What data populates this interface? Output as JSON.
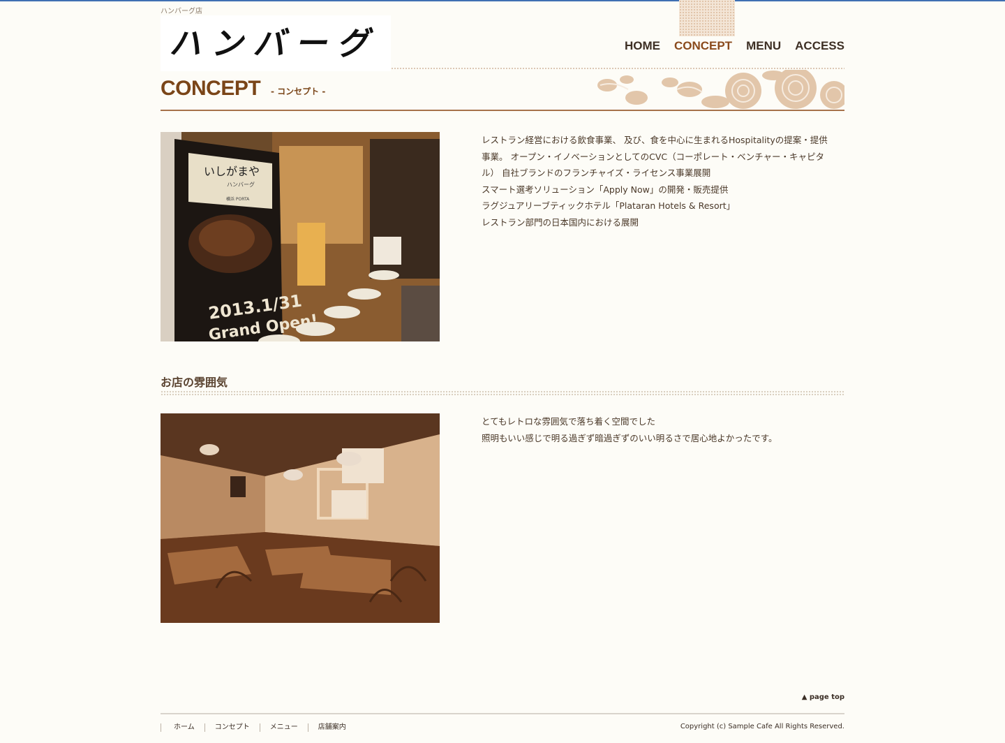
{
  "header": {
    "tagline": "ハンバーグ店",
    "logo_text": "ハンバーグ"
  },
  "nav": {
    "items": [
      {
        "label": "HOME"
      },
      {
        "label": "CONCEPT"
      },
      {
        "label": "MENU"
      },
      {
        "label": "ACCESS"
      }
    ],
    "active": "CONCEPT"
  },
  "page": {
    "title": "CONCEPT",
    "subtitle": "- コンセプト -"
  },
  "concept": {
    "lines": [
      "レストラン経営における飲食事業、 及び、食を中心に生まれるHospitalityの提案・提供",
      "事業。 オープン・イノベーションとしてのCVC（コーポレート・ベンチャー・キャピタ",
      "ル） 自社ブランドのフランチャイズ・ライセンス事業展開",
      "スマート選考ソリューション「Apply Now」の開発・販売提供",
      "ラグジュアリーブティックホテル「Plataran Hotels & Resort」",
      "レストラン部門の日本国内における展開"
    ],
    "photo_sign": {
      "logo": "いしがまや",
      "sub": "ハンバーグ",
      "location": "横浜 PORTA",
      "date": "2013.1/31",
      "open": "Grand Open!"
    }
  },
  "atmosphere": {
    "heading": "お店の雰囲気",
    "lines": [
      "とてもレトロな雰囲気で落ち着く空間でした",
      "照明もいい感じで明る過ぎず暗過ぎずのいい明るさで居心地よかったです。"
    ]
  },
  "footer": {
    "pagetop": "▲ page top",
    "links": [
      "ホーム",
      "コンセプト",
      "メニュー",
      "店舗案内"
    ],
    "copyright": "Copyright (c) Sample Cafe All Rights Reserved."
  },
  "colors": {
    "accent": "#7a4518",
    "background": "#fdfcf7",
    "text": "#4a3828"
  }
}
